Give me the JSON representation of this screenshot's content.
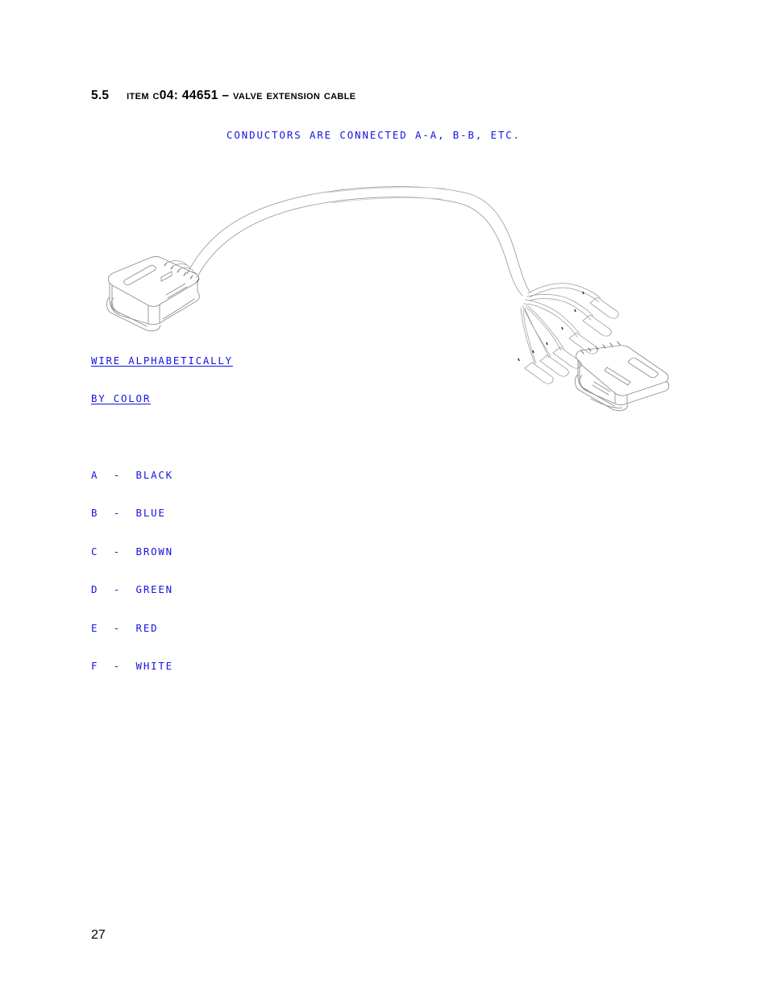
{
  "document": {
    "page_number": "27"
  },
  "heading": {
    "number": "5.5",
    "title": "Item C04: 44651 – Valve Extension Cable"
  },
  "drawing": {
    "note": "CONDUCTORS ARE CONNECTED A-A, B-B, ETC.",
    "legend": {
      "head_line1": "WIRE ALPHABETICALLY",
      "head_line2": "BY COLOR",
      "rows": [
        "A  -  BLACK",
        "B  -  BLUE",
        "C  -  BROWN",
        "D  -  GREEN",
        "E  -  RED",
        "F  -  WHITE"
      ]
    },
    "colors": {
      "cad_blue": "#1414e0",
      "line": "#7a7a7a",
      "line_dark": "#4a4a4a",
      "text": "#000000"
    },
    "parts": {
      "left_connector": "6-pin rectangular valve connector body",
      "right_connector": "6-pin rectangular valve connector body",
      "cable": "arched multi-conductor cable",
      "wire_fan": "6 individual conductors with pin terminals"
    }
  }
}
